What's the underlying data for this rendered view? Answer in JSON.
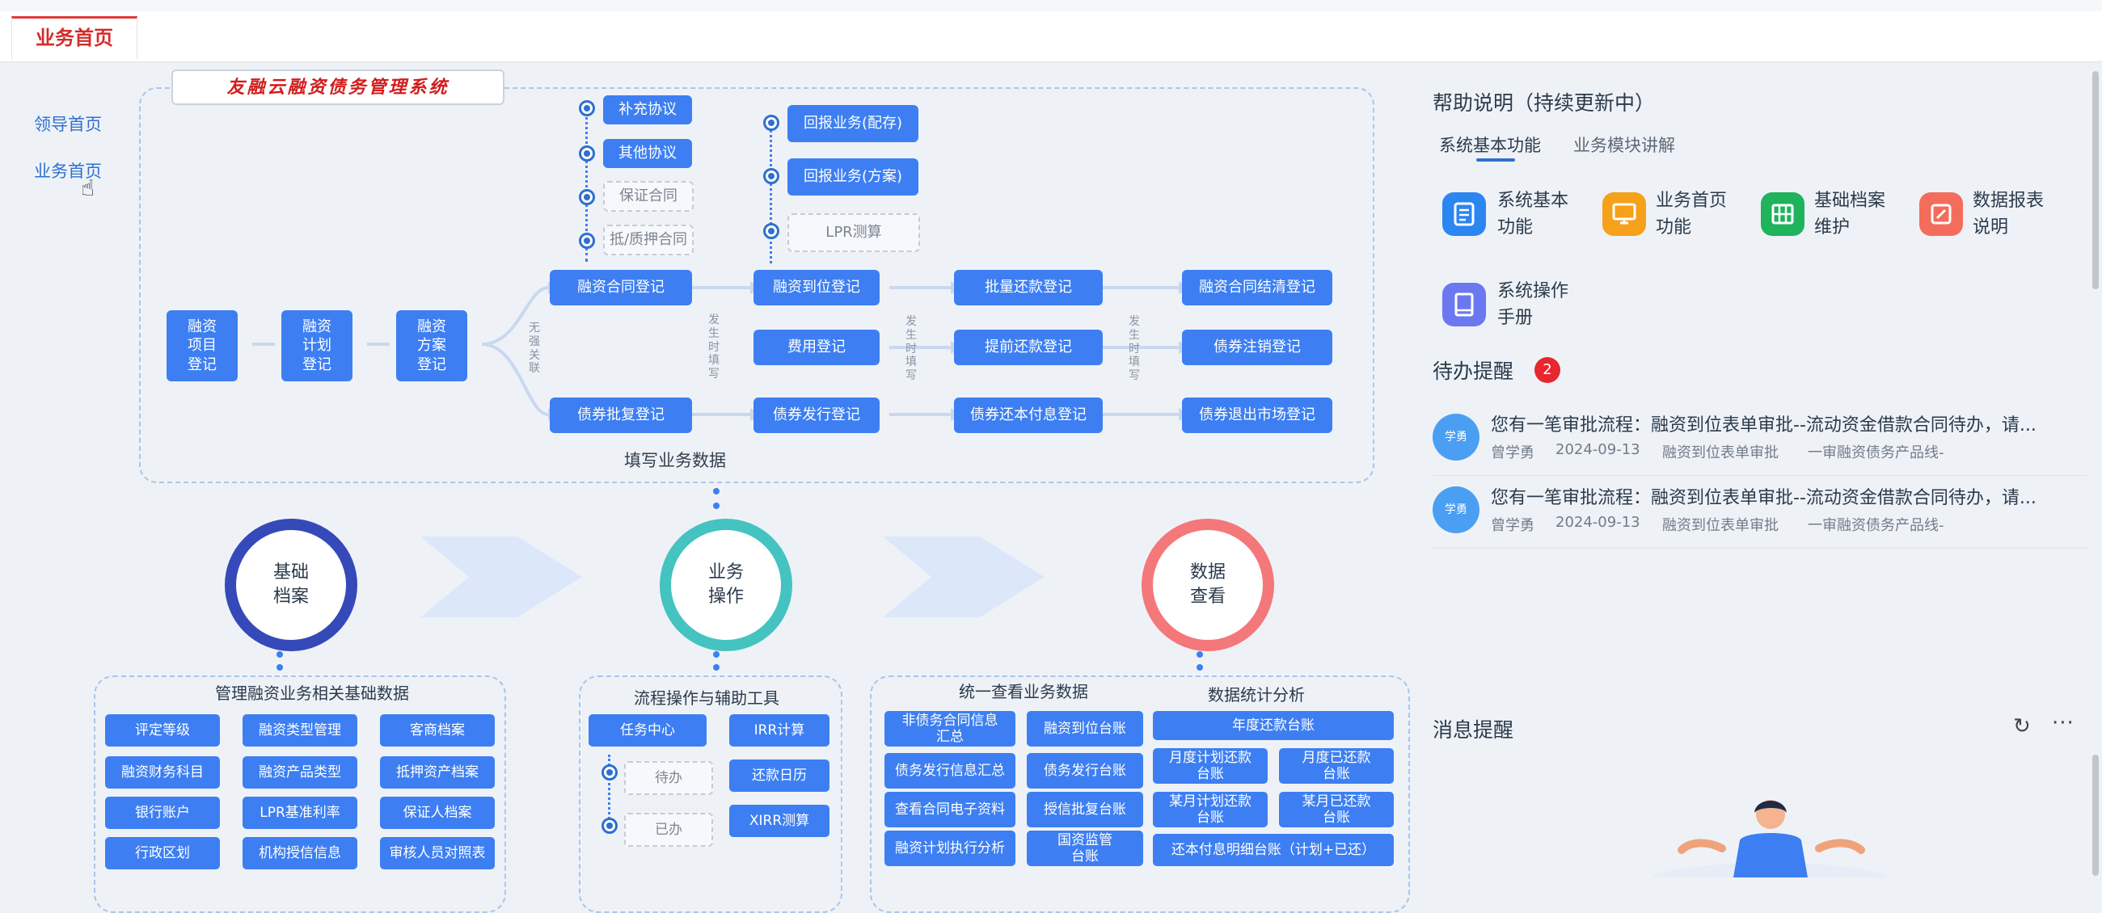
{
  "tab": {
    "label": "业务首页"
  },
  "sidebar": {
    "items": [
      {
        "label": "领导首页"
      },
      {
        "label": "业务首页"
      }
    ]
  },
  "flow": {
    "system_title": "友融云融资债务管理系统",
    "column_start": [
      "融资\n项目\n登记",
      "融资\n计划\n登记",
      "融资\n方案\n登记"
    ],
    "no_relation_label": "无强关联",
    "occur_label_a": "发生时填写",
    "occur_label_b": "发生时填写",
    "occur_label_c": "发生时填写",
    "contract_extras": [
      "补充协议",
      "其他协议",
      "保证合同",
      "抵/质押合同"
    ],
    "repo_extras": [
      "回报业务(配存)",
      "回报业务(方案)",
      "LPR测算"
    ],
    "row1": [
      "融资合同登记",
      "融资到位登记",
      "批量还款登记",
      "融资合同结清登记"
    ],
    "row2": [
      "费用登记",
      "提前还款登记",
      "债券注销登记"
    ],
    "row3": [
      "债券批复登记",
      "债券发行登记",
      "债券还本付息登记",
      "债券退出市场登记"
    ],
    "fill_label": "填写业务数据"
  },
  "circles": [
    {
      "label": "基础\n档案",
      "color": "#3549b9"
    },
    {
      "label": "业务\n操作",
      "color": "#44c3c0"
    },
    {
      "label": "数据\n查看",
      "color": "#f4777a"
    }
  ],
  "panel_basic": {
    "title": "管理融资业务相关基础数据",
    "items": [
      "评定等级",
      "融资类型管理",
      "客商档案",
      "融资财务科目",
      "融资产品类型",
      "抵押资产档案",
      "银行账户",
      "LPR基准利率",
      "保证人档案",
      "行政区划",
      "机构授信信息",
      "审核人员对照表"
    ]
  },
  "panel_ops": {
    "title": "流程操作与辅助工具",
    "task_center": "任务中心",
    "pending": "待办",
    "done": "已办",
    "tools": [
      "IRR计算",
      "还款日历",
      "XIRR测算"
    ]
  },
  "panel_view": {
    "title_left": "统一查看业务数据",
    "title_right": "数据统计分析",
    "left_items": [
      "非债务合同信息\n汇总",
      "债务发行信息汇总",
      "查看合同电子资料",
      "融资计划执行分析"
    ],
    "mid_items": [
      "融资到位台账",
      "债务发行台账",
      "授信批复台账",
      "国资监管\n台账"
    ],
    "right_items": [
      "年度还款台账",
      "月度计划还款\n台账",
      "月度已还款\n台账",
      "某月计划还款\n台账",
      "某月已还款\n台账",
      "还本付息明细台账（计划+已还）"
    ]
  },
  "help": {
    "title": "帮助说明（持续更新中）",
    "tabs": [
      "系统基本功能",
      "业务模块讲解"
    ],
    "features": [
      {
        "label": "系统基本\n功能",
        "icon": "document-icon",
        "color": "#2c86f0"
      },
      {
        "label": "业务首页\n功能",
        "icon": "monitor-icon",
        "color": "#f6a11a"
      },
      {
        "label": "基础档案\n维护",
        "icon": "archive-icon",
        "color": "#1fb35c"
      },
      {
        "label": "数据报表\n说明",
        "icon": "edit-icon",
        "color": "#f46d5c"
      },
      {
        "label": "系统操作\n手册",
        "icon": "book-icon",
        "color": "#6b78f0"
      }
    ]
  },
  "todo": {
    "title": "待办提醒",
    "count": "2",
    "items": [
      {
        "avatar": "学勇",
        "text": "您有一笔审批流程：融资到位表单审批--流动资金借款合同待办，请...",
        "user": "曾学勇",
        "date": "2024-09-13",
        "type": "融资到位表单审批",
        "line": "一审融资债务产品线-"
      },
      {
        "avatar": "学勇",
        "text": "您有一笔审批流程：融资到位表单审批--流动资金借款合同待办，请...",
        "user": "曾学勇",
        "date": "2024-09-13",
        "type": "融资到位表单审批",
        "line": "一审融资债务产品线-"
      }
    ]
  },
  "messages": {
    "title": "消息提醒"
  }
}
